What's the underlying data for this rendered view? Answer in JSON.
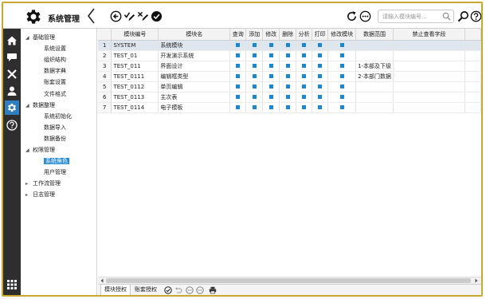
{
  "header": {
    "title": "系统管理",
    "search_placeholder": "请输入模块编号..."
  },
  "nav": {
    "groups": [
      {
        "label": "基础管理",
        "expanded": true,
        "children": [
          "系统设置",
          "组织结构",
          "数据字典",
          "账套设置",
          "文件格式"
        ]
      },
      {
        "label": "数据整理",
        "expanded": true,
        "children": [
          "系统初始化",
          "数据导入",
          "数据备份"
        ]
      },
      {
        "label": "权限管理",
        "expanded": true,
        "children": [
          "系统角色",
          "用户管理"
        ]
      },
      {
        "label": "工作流管理",
        "expanded": false,
        "children": []
      },
      {
        "label": "日志管理",
        "expanded": false,
        "children": []
      }
    ],
    "selected": "系统角色"
  },
  "grid": {
    "columns": [
      "模块编号",
      "模块名",
      "查询",
      "添加",
      "修改",
      "删除",
      "分析",
      "打印",
      "修改模块",
      "数据范围",
      "禁止查看字段"
    ],
    "rows": [
      {
        "num": "1",
        "code": "SYSTEM",
        "name": "系统模块",
        "perms": [
          true,
          true,
          true,
          true,
          true,
          true,
          true
        ],
        "scope": "",
        "selected": true
      },
      {
        "num": "2",
        "code": "TEST_01",
        "name": "开发演示系统",
        "perms": [
          true,
          true,
          true,
          true,
          true,
          true,
          true
        ],
        "scope": "",
        "selected": false
      },
      {
        "num": "3",
        "code": "TEST_011",
        "name": "界面设计",
        "perms": [
          true,
          true,
          true,
          true,
          true,
          true,
          true
        ],
        "scope": "1-本部及下级",
        "selected": false
      },
      {
        "num": "4",
        "code": "TEST_0111",
        "name": "编辑框类型",
        "perms": [
          true,
          true,
          true,
          true,
          true,
          true,
          true
        ],
        "scope": "2-本部门数据",
        "selected": false
      },
      {
        "num": "5",
        "code": "TEST_0112",
        "name": "单页编辑",
        "perms": [
          true,
          true,
          true,
          true,
          true,
          true,
          true
        ],
        "scope": "",
        "selected": false
      },
      {
        "num": "6",
        "code": "TEST_0113",
        "name": "主次表",
        "perms": [
          true,
          true,
          true,
          true,
          true,
          true,
          true
        ],
        "scope": "",
        "selected": false
      },
      {
        "num": "7",
        "code": "TEST_0114",
        "name": "电子模板",
        "perms": [
          true,
          true,
          true,
          true,
          true,
          true,
          true
        ],
        "scope": "",
        "selected": false
      }
    ]
  },
  "bottom": {
    "tabs": [
      "模块授权",
      "账套授权"
    ],
    "active": "模块授权"
  },
  "colors": {
    "accent": "#2a8bd6",
    "frame": "#c8a830",
    "sidebar": "#2e2e2e"
  }
}
